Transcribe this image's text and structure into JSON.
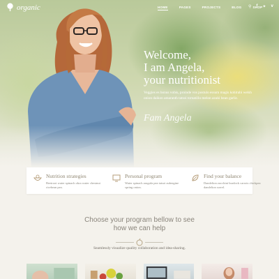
{
  "nav": {
    "logo_text": "organic",
    "menu": [
      "HOME",
      "PAGES",
      "PROJECTS",
      "BLOG",
      "SHOP"
    ],
    "active_index": 0,
    "icons": [
      "search-icon",
      "facebook-icon",
      "twitter-icon",
      "vimeo-icon"
    ]
  },
  "hero": {
    "welcome_line1": "Welcome,",
    "welcome_line2": "I am Angela,",
    "welcome_line3": "your nutritionist",
    "intro": "Veggies es bonus vobis, proinde vos postulo essum magis kohlrabi welsh onion daikon amaranth tatsoi tomatillo melon azuki bean garlic.",
    "signature": "Fam Angela"
  },
  "features": [
    {
      "icon": "bowl-icon",
      "title": "Nutrition strategies",
      "text": "Beetroot water spinach okra water chestnut ricebean pea."
    },
    {
      "icon": "screen-icon",
      "title": "Personal program",
      "text": "Water spinach arugula pea tatsoi aubergine spring onion."
    },
    {
      "icon": "leaf-icon",
      "title": "Find your balance",
      "text": "Dandelion zucchini burdock carrots chickpea dandelion sorrel."
    }
  ],
  "section": {
    "title_line1": "Choose your program bellow to see",
    "title_line2": "how we can help",
    "subtitle": "Seamlessly visualize quality collaboration and idea-sharing."
  },
  "colors": {
    "accent": "#b59c78",
    "background": "#f4f2ec"
  }
}
